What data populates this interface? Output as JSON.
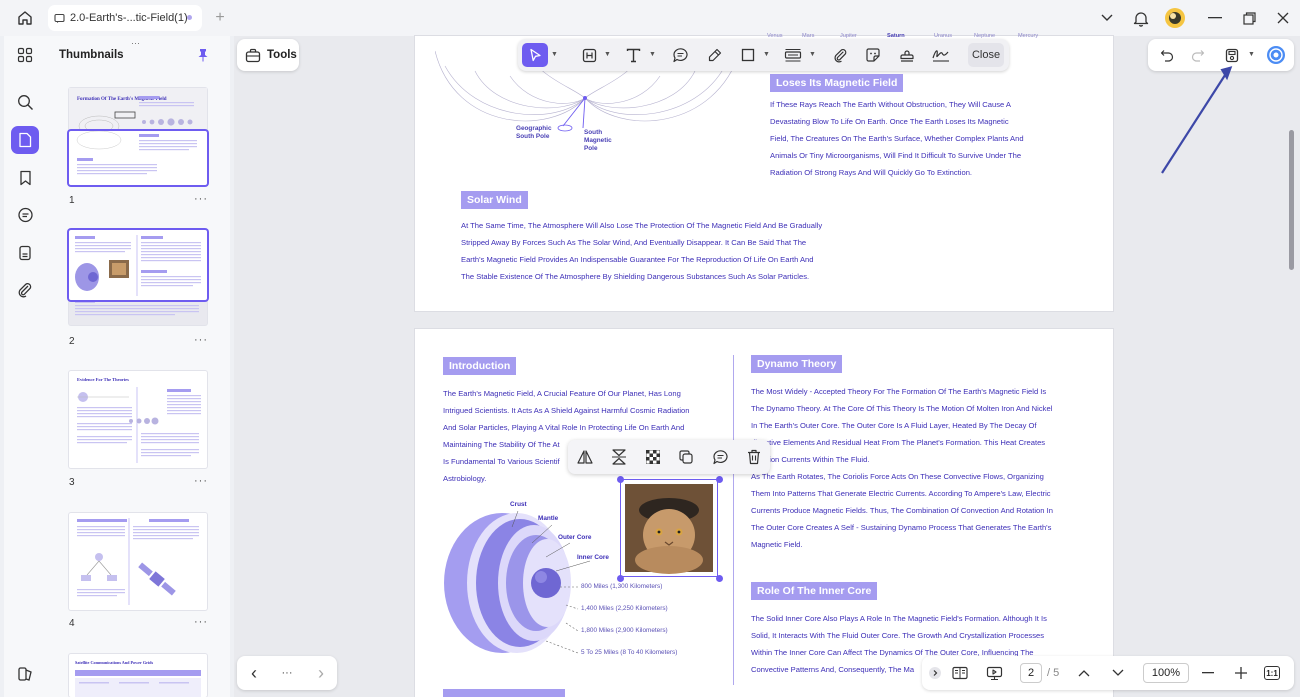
{
  "titlebar": {
    "tab_title": "2.0-Earth's-...tic-Field(1)",
    "home_icon": "home-icon",
    "new_tab": "+"
  },
  "thumbnails": {
    "title": "Thumbnails",
    "pages": [
      {
        "number": "1",
        "heading": "Formation Of The Earth's Magnetic Field"
      },
      {
        "number": "2",
        "heading": ""
      },
      {
        "number": "3",
        "heading": "Evidence For The Theories"
      },
      {
        "number": "4",
        "heading": ""
      },
      {
        "number": "",
        "heading": "Satellite Communications And Power Grids"
      }
    ],
    "more": "···"
  },
  "toolbar": {
    "tools_label": "Tools",
    "close_label": "Close"
  },
  "page1": {
    "planets": [
      "Venus",
      "Mars",
      "Jupiter",
      "Saturn",
      "Uranus",
      "Neptune",
      "Mercury"
    ],
    "geo_pole": [
      "Geographic",
      "South Pole"
    ],
    "mag_pole": [
      "South",
      "Magnetic",
      "Pole"
    ],
    "loses_heading": "Loses Its Magnetic Field",
    "loses_text": [
      "If These Rays Reach The Earth Without Obstruction, They Will Cause A",
      "Devastating Blow To Life On Earth. Once The Earth Loses Its Magnetic",
      "Field, The Creatures On The Earth's Surface, Whether Complex Plants And",
      "Animals Or Tiny Microorganisms, Will Find It Difficult To Survive Under The",
      "Radiation Of Strong Rays And Will Quickly Go To Extinction."
    ],
    "solar_heading": "Solar Wind",
    "solar_text": [
      "At The Same Time, The Atmosphere Will Also Lose The Protection Of The Magnetic Field And Be Gradually",
      "Stripped Away By Forces Such As The Solar Wind, And Eventually Disappear. It Can Be Said That The",
      "Earth's Magnetic Field Provides An Indispensable Guarantee For The Reproduction Of Life On Earth And",
      "The Stable Existence Of The Atmosphere By Shielding Dangerous Substances Such As Solar Particles."
    ]
  },
  "page2": {
    "intro_heading": "Introduction",
    "intro_text": [
      "The Earth's Magnetic Field, A Crucial Feature Of Our Planet, Has Long",
      "Intrigued Scientists. It Acts As A Shield Against Harmful Cosmic Radiation",
      "And Solar Particles, Playing A Vital Role In Protecting Life On Earth And",
      "Maintaining The Stability Of The At",
      "Is Fundamental To Various Scientif",
      "Astrobiology."
    ],
    "layers": [
      "Crust",
      "Mantle",
      "Outer Core",
      "Inner Core"
    ],
    "distances": [
      "800 Miles (1,300 Kilometers)",
      "1,400 Miles (2,250 Kilometers)",
      "1,800 Miles (2,900 Kilometers)",
      "5 To 25 Miles (8 To 40 Kilometers)"
    ],
    "dynamo_heading": "Dynamo Theory",
    "dynamo_text": [
      "The Most Widely - Accepted Theory For The Formation Of The Earth's Magnetic Field Is",
      "The Dynamo Theory. At The Core Of This Theory Is The Motion Of Molten Iron And Nickel",
      "In The Earth's Outer Core. The Outer Core Is A Fluid Layer, Heated By The Decay Of",
      "dioactive Elements And Residual Heat From The Planet's Formation. This Heat Creates",
      "nvection Currents Within The Fluid.",
      "As The Earth Rotates, The Coriolis Force Acts On These Convective Flows, Organizing",
      "Them Into Patterns That Generate Electric Currents. According To Ampere's Law, Electric",
      "Currents Produce Magnetic Fields. Thus, The Combination Of Convection And Rotation In",
      "The Outer Core Creates A Self - Sustaining Dynamo Process That Generates The Earth's",
      "Magnetic Field."
    ],
    "inner_heading": "Role Of The Inner Core",
    "inner_text": [
      "The Solid Inner Core Also Plays A Role In The Magnetic Field's Formation. Although It Is",
      "Solid, It Interacts With The Fluid Outer Core. The Growth And Crystallization Processes",
      "Within The Inner Core Can Affect The Dynamics Of The Outer Core, Influencing The",
      "Convective Patterns And, Consequently, The Ma"
    ]
  },
  "navigation": {
    "prev": "‹",
    "more": "···",
    "next": "›"
  },
  "statusbar": {
    "current_page": "2",
    "total_pages": "/ 5",
    "zoom": "100%",
    "fit_label": "1:1"
  },
  "colors": {
    "accent": "#6e5cf0",
    "heading_fill": "#a59cf0",
    "doc_text": "#3d2fb7"
  }
}
